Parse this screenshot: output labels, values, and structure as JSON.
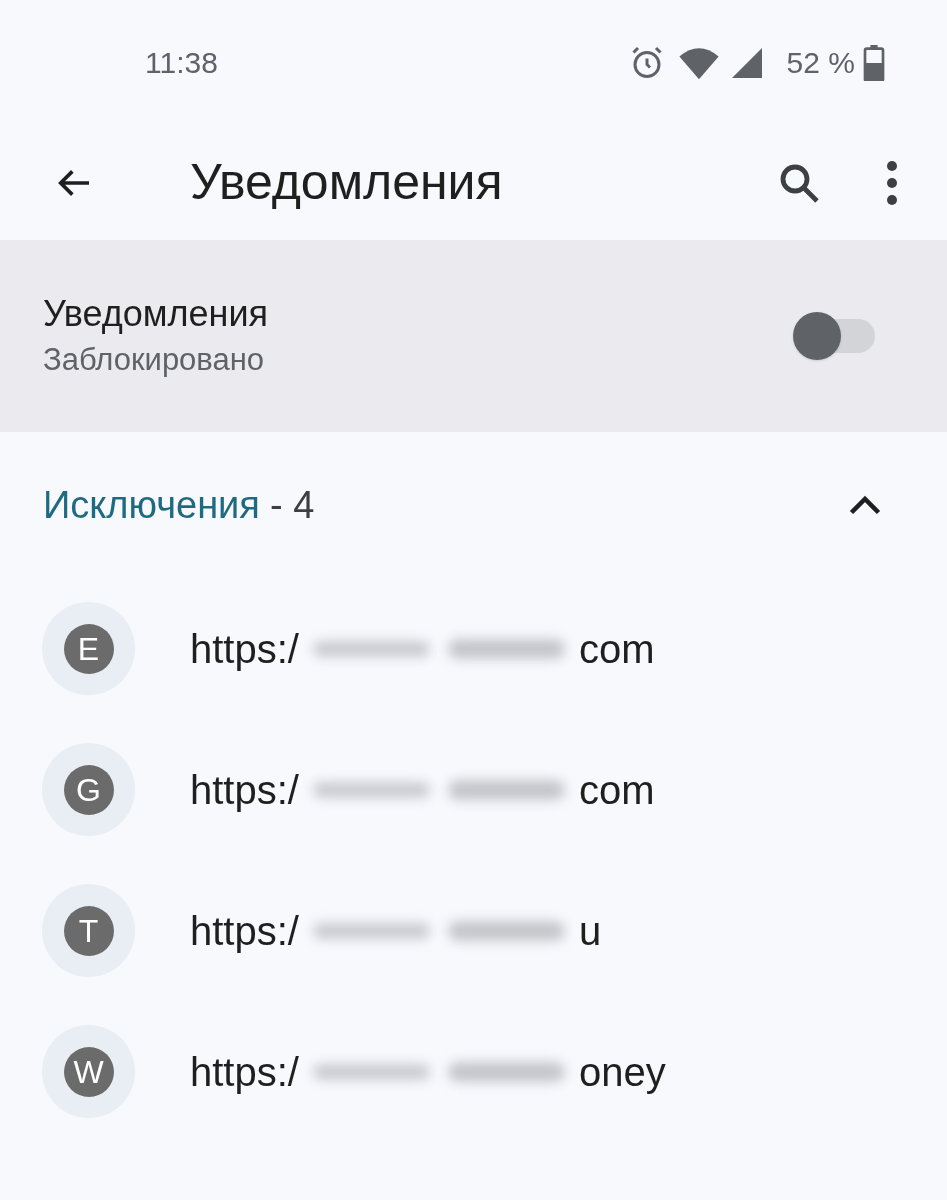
{
  "status_bar": {
    "time": "11:38",
    "battery": "52 %"
  },
  "app_bar": {
    "title": "Уведомления"
  },
  "master_toggle": {
    "label": "Уведомления",
    "summary": "Заблокировано",
    "on": false
  },
  "exceptions": {
    "title": "Исключения",
    "count": "- 4",
    "expanded": true
  },
  "sites": [
    {
      "letter": "E",
      "prefix": "https:/",
      "suffix": "com"
    },
    {
      "letter": "G",
      "prefix": "https:/",
      "suffix": "com"
    },
    {
      "letter": "T",
      "prefix": "https:/",
      "suffix": "u"
    },
    {
      "letter": "W",
      "prefix": "https:/",
      "suffix": "oney"
    }
  ]
}
